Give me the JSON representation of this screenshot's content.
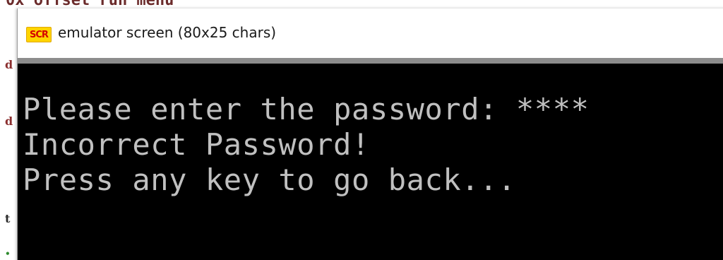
{
  "background_editor": {
    "top_line": "0x offset run menu",
    "gutter": [
      "d",
      "d",
      "t"
    ]
  },
  "window": {
    "icon_label": "SCR",
    "title": "emulator screen (80x25 chars)"
  },
  "console": {
    "lines": [
      "Please enter the password: ****",
      "Incorrect Password!",
      "Press any key to go back..."
    ]
  }
}
